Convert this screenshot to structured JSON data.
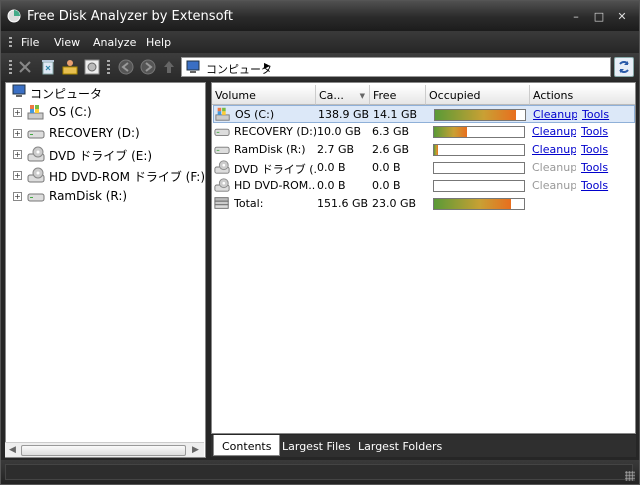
{
  "window": {
    "title": "Free Disk Analyzer by Extensoft",
    "min_glyph": "–",
    "max_glyph": "□",
    "close_glyph": "✕"
  },
  "menu": [
    "File",
    "View",
    "Analyze",
    "Help"
  ],
  "toolbar": {
    "icons": [
      "delete-icon",
      "recycle-bin-icon",
      "user-folder-icon",
      "disk-properties-icon",
      "back-icon",
      "forward-icon",
      "up-icon",
      "refresh-icon"
    ]
  },
  "address": {
    "path": "コンピュータ",
    "arrow": "▶"
  },
  "tree": {
    "root": "コンピュータ",
    "items": [
      {
        "label": "OS (C:)",
        "icon": "windows-drive-icon"
      },
      {
        "label": "RECOVERY (D:)",
        "icon": "hard-drive-icon"
      },
      {
        "label": "DVD ドライブ (E:)",
        "icon": "dvd-drive-icon"
      },
      {
        "label": "HD DVD-ROM ドライブ (F:)",
        "icon": "dvd-drive-icon"
      },
      {
        "label": "RamDisk (R:)",
        "icon": "hard-drive-icon"
      }
    ],
    "expander": "+"
  },
  "list": {
    "columns": [
      "Volume",
      "Ca...",
      "Free",
      "Occupied",
      "Actions"
    ],
    "sort_glyph": "▼",
    "rows": [
      {
        "volume": "OS (C:)",
        "capacity": "138.9 GB",
        "free": "14.1 GB",
        "occupied": 0.9,
        "cleanup": "Cleanup",
        "tools": "Tools",
        "enabled": true,
        "icon": "windows-drive-icon"
      },
      {
        "volume": "RECOVERY (D:)",
        "capacity": "10.0 GB",
        "free": "6.3 GB",
        "occupied": 0.37,
        "cleanup": "Cleanup",
        "tools": "Tools",
        "enabled": true,
        "icon": "hard-drive-icon"
      },
      {
        "volume": "RamDisk (R:)",
        "capacity": "2.7 GB",
        "free": "2.6 GB",
        "occupied": 0.04,
        "cleanup": "Cleanup",
        "tools": "Tools",
        "enabled": true,
        "icon": "hard-drive-icon"
      },
      {
        "volume": "DVD ドライブ (...",
        "capacity": "0.0 B",
        "free": "0.0 B",
        "occupied": 0,
        "cleanup": "Cleanup",
        "tools": "Tools",
        "enabled": false,
        "icon": "dvd-drive-icon"
      },
      {
        "volume": "HD DVD-ROM...",
        "capacity": "0.0 B",
        "free": "0.0 B",
        "occupied": 0,
        "cleanup": "Cleanup",
        "tools": "Tools",
        "enabled": false,
        "icon": "dvd-drive-icon"
      },
      {
        "volume": "Total:",
        "capacity": "151.6 GB",
        "free": "23.0 GB",
        "occupied": 0.85,
        "cleanup": "",
        "tools": "",
        "enabled": false,
        "icon": "total-drives-icon"
      }
    ]
  },
  "tabs": [
    "Contents",
    "Largest Files",
    "Largest Folders"
  ],
  "colors": {
    "bar_start": "#5a9a36",
    "bar_mid": "#c9a034",
    "bar_end": "#e86e1e",
    "link": "#0000cc",
    "selection": "#dce8f8"
  }
}
